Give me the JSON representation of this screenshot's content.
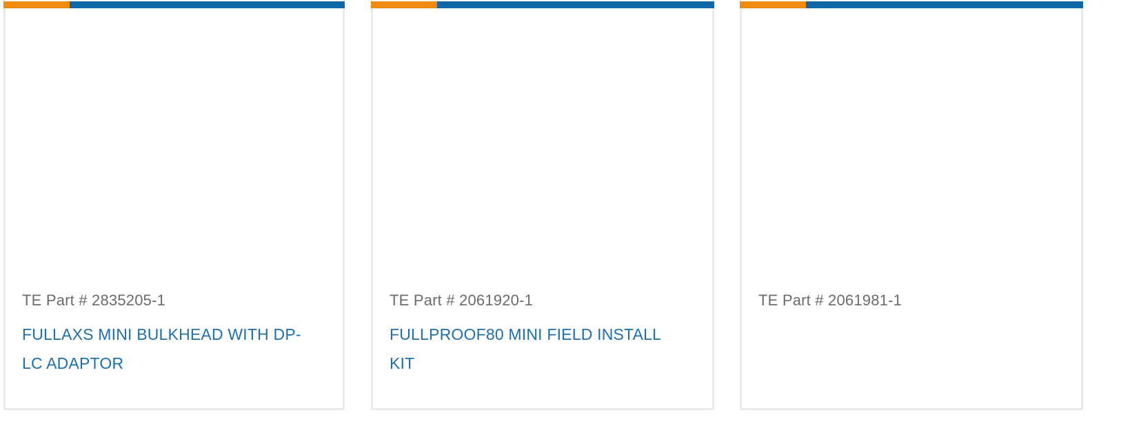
{
  "colors": {
    "accent_orange": "#f08a0a",
    "accent_blue": "#0e67a6",
    "link_blue": "#1d6eaa",
    "muted_text": "#6b6b6b",
    "card_border": "#ebebeb"
  },
  "products": [
    {
      "part_number": "TE Part # 2835205-1",
      "name": "FULLAXS MINI BULKHEAD WITH DP-LC ADAPTOR"
    },
    {
      "part_number": "TE Part # 2061920-1",
      "name": "FULLPROOF80 MINI FIELD INSTALL KIT"
    },
    {
      "part_number": "TE Part # 2061981-1",
      "name": ""
    }
  ]
}
